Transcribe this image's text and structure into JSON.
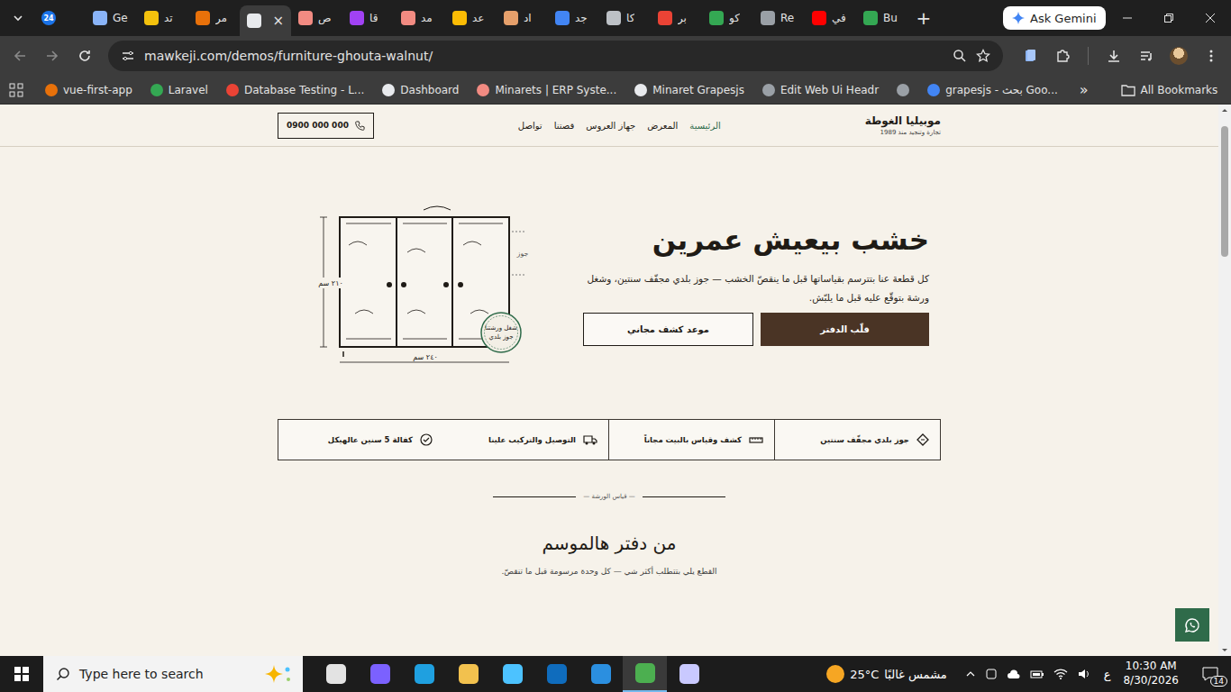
{
  "browser": {
    "tabs": [
      {
        "label": "",
        "badge": "24",
        "selected": false,
        "color": "#1a73e8"
      },
      {
        "label": "Ge",
        "badge": "",
        "selected": false,
        "color": "#8ab4f8"
      },
      {
        "label": "تد",
        "badge": "",
        "selected": false,
        "color": "#f4c20d"
      },
      {
        "label": "مر",
        "badge": "",
        "selected": false,
        "color": "#e8710a"
      },
      {
        "label": "",
        "badge": "",
        "selected": true,
        "color": "#e8eaed"
      },
      {
        "label": "ص",
        "badge": "",
        "selected": false,
        "color": "#f28b82"
      },
      {
        "label": "قا",
        "badge": "",
        "selected": false,
        "color": "#a142f4"
      },
      {
        "label": "مد",
        "badge": "",
        "selected": false,
        "color": "#f28b82"
      },
      {
        "label": "عد",
        "badge": "",
        "selected": false,
        "color": "#fbbc04"
      },
      {
        "label": "اد",
        "badge": "",
        "selected": false,
        "color": "#e6a06b"
      },
      {
        "label": "جد",
        "badge": "",
        "selected": false,
        "color": "#4285f4"
      },
      {
        "label": "كا",
        "badge": "",
        "selected": false,
        "color": "#bdc1c6"
      },
      {
        "label": "بر",
        "badge": "",
        "selected": false,
        "color": "#ea4335"
      },
      {
        "label": "كو",
        "badge": "",
        "selected": false,
        "color": "#34a853"
      },
      {
        "label": "Re",
        "badge": "",
        "selected": false,
        "color": "#9aa0a6"
      },
      {
        "label": "في",
        "badge": "",
        "selected": false,
        "color": "#ff0000"
      },
      {
        "label": "Bu",
        "badge": "",
        "selected": false,
        "color": "#34a853"
      }
    ],
    "close_glyph": "×",
    "new_tab": "+",
    "ask_gemini": "Ask Gemini",
    "url": "mawkeji.com/demos/furniture-ghouta-walnut/",
    "bookmarks": [
      {
        "label": "vue-first-app",
        "color": "#e8710a"
      },
      {
        "label": "Laravel",
        "color": "#34a853"
      },
      {
        "label": "Database Testing - L...",
        "color": "#ea4335"
      },
      {
        "label": "Dashboard",
        "color": "#e8eaed"
      },
      {
        "label": "Minarets | ERP Syste...",
        "color": "#f28b82"
      },
      {
        "label": "Minaret Grapesjs",
        "color": "#e8eaed"
      },
      {
        "label": "Edit Web Ui Headr",
        "color": "#9aa0a6"
      },
      {
        "label": "",
        "color": "#9aa0a6"
      },
      {
        "label": "grapesjs - بحث Goo...",
        "color": "#4285f4"
      }
    ],
    "bookmarks_overflow": "»",
    "all_bookmarks": "All Bookmarks"
  },
  "site": {
    "logo": "موبيليا الغوطة",
    "tagline": "تجارة وتنجيد منذ 1989",
    "nav": [
      {
        "label": "الرئيسية",
        "selected": true
      },
      {
        "label": "المعرض",
        "selected": false
      },
      {
        "label": "جهاز العروس",
        "selected": false
      },
      {
        "label": "قصتنا",
        "selected": false
      },
      {
        "label": "تواصل",
        "selected": false
      }
    ],
    "phone": "0900 000 000",
    "hero": {
      "title": "خشب بيعيش عمرين",
      "text": "كل قطعة عنا بتترسم بقياساتها قبل ما ينقصّ الخشب — جوز بلدي مجفّف سنتين، وشغل ورشة بتوقّع عليه قبل ما يلبّش.",
      "primary_button": "قلّب الدفتر",
      "secondary_button": "موعد كشف مجاني"
    },
    "sketch": {
      "height_label": "٢١٠ سم",
      "width_label": "٢٤٠ سم",
      "material_label": "جوز",
      "stamp": [
        "شغل ورشتنا",
        "جوز بلدي"
      ]
    },
    "features": [
      {
        "label": "جوز بلدي مجفّف سنتين"
      },
      {
        "label": "كشف وقياس بالبيت مجاناً"
      },
      {
        "label": "التوصيل والتركيب علينا"
      },
      {
        "label": "كفالة 5 سنين عالهيكل"
      }
    ],
    "section": {
      "eyebrow": "— قياس الورشة —",
      "title": "من دفتر هالموسم",
      "subtitle": "القطع يلي بتتطلب أكثر شي — كل وحدة مرسومة قبل ما تنقصّ."
    }
  },
  "taskbar": {
    "search_placeholder": "Type here to search",
    "apps": [
      {
        "selected": false,
        "color": "#e3e3e3"
      },
      {
        "selected": false,
        "color": "#7b61ff"
      },
      {
        "selected": false,
        "color": "#1fa0e0"
      },
      {
        "selected": false,
        "color": "#f2c14e"
      },
      {
        "selected": false,
        "color": "#4cc2ff"
      },
      {
        "selected": false,
        "color": "#0f6cbd"
      },
      {
        "selected": false,
        "color": "#2b8fe0"
      },
      {
        "selected": true,
        "color": "#4caf50"
      },
      {
        "selected": false,
        "color": "#c9c9ff"
      }
    ],
    "weather_temp": "25°C",
    "weather_text": "مشمس غالبًا",
    "language": "ع",
    "time": "10:30 AM",
    "date": "8/30/2026",
    "notifications": "14"
  }
}
